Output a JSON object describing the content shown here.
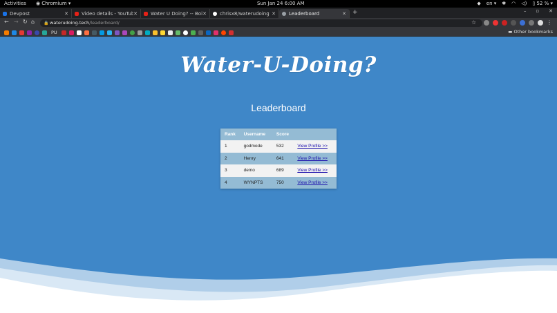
{
  "os_bar": {
    "activities": "Activities",
    "app_name": "Chromium",
    "clock": "Sun Jan 24  6:00 AM",
    "lang": "en",
    "battery": "52 %"
  },
  "tabs": [
    {
      "title": "Devpost",
      "color": "#1a73e8"
    },
    {
      "title": "Video details - YouTube S",
      "color": "#e62117"
    },
    {
      "title": "Water U Doing? -- Boiler",
      "color": "#e62117"
    },
    {
      "title": "chrisx8/waterudoing",
      "color": "#ffffff"
    },
    {
      "title": "Leaderboard",
      "color": "#9aa0a6"
    }
  ],
  "new_tab": "+",
  "window_controls": {
    "minimize": "–",
    "maximize": "▫",
    "close": "✕"
  },
  "address": {
    "domain": "waterudoing.tech",
    "path": "/leaderboard/"
  },
  "bookmarks": {
    "folder_label": "PU",
    "other": "Other bookmarks"
  },
  "page": {
    "site_title": "Water-U-Doing?",
    "heading": "Leaderboard"
  },
  "leaderboard": {
    "headers": [
      "Rank",
      "Username",
      "Score",
      ""
    ],
    "rows": [
      {
        "rank": "1",
        "username": "godmode",
        "score": "532",
        "link": "View Profile >>"
      },
      {
        "rank": "2",
        "username": "Henry",
        "score": "641",
        "link": "View Profile >>"
      },
      {
        "rank": "3",
        "username": "demo",
        "score": "689",
        "link": "View Profile >>"
      },
      {
        "rank": "4",
        "username": "WYNPTS",
        "score": "750",
        "link": "View Profile >>"
      }
    ]
  },
  "colors": {
    "page_bg": "#3f87c8",
    "table_header": "#94bbd4",
    "table_row_light": "#f2f2f2"
  }
}
